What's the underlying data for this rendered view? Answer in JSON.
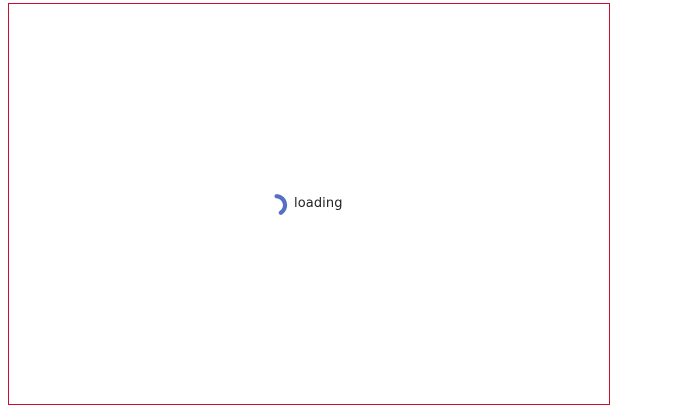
{
  "loader": {
    "text": "loading",
    "spinner_icon": "spinner-arc-icon",
    "spinner_color": "#5470c6"
  },
  "frame": {
    "border_color": "#c8102e"
  }
}
